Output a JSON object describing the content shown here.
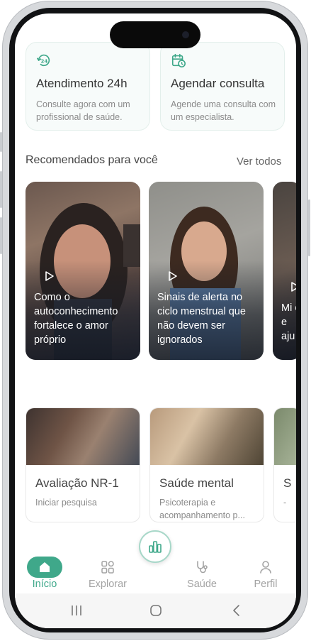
{
  "services": [
    {
      "icon": "24h-clock-icon",
      "title": "Atendimento 24h",
      "desc": "Consulte agora com um profissional de saúde."
    },
    {
      "icon": "calendar-clock-icon",
      "title": "Agendar consulta",
      "desc": "Agende uma consulta com um especialista."
    }
  ],
  "recommended": {
    "title": "Recomendados para você",
    "see_all": "Ver todos",
    "videos": [
      {
        "caption": "Como o autoconhecimento fortalece o amor próprio"
      },
      {
        "caption": "Sinais de alerta no ciclo menstrual que não devem ser ignorados"
      },
      {
        "caption": "Mi é e aju"
      }
    ]
  },
  "cards": [
    {
      "title": "Avaliação NR-1",
      "sub": "Iniciar pesquisa"
    },
    {
      "title": "Saúde mental",
      "sub": "Psicoterapia e acompanhamento p..."
    },
    {
      "title": "S",
      "sub": "-"
    }
  ],
  "nav": {
    "items": [
      {
        "label": "Início",
        "active": true
      },
      {
        "label": "Explorar",
        "active": false
      },
      {
        "label": "Saúde",
        "active": false
      },
      {
        "label": "Perfil",
        "active": false
      }
    ],
    "center_icon": "bar-chart-icon"
  },
  "colors": {
    "accent": "#3fa88a",
    "accent_light": "#a8d8c9"
  }
}
